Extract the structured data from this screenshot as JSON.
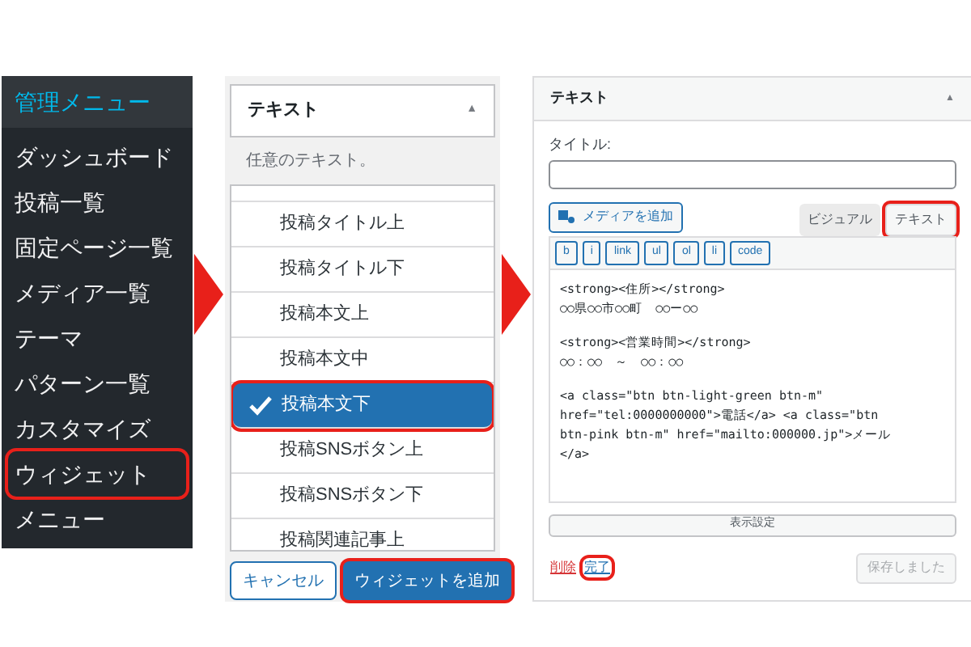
{
  "admin_menu": {
    "title": "管理メニュー",
    "items": [
      {
        "label": "ダッシュボード",
        "highlighted": false
      },
      {
        "label": "投稿一覧",
        "highlighted": false
      },
      {
        "label": "固定ページ一覧",
        "highlighted": false
      },
      {
        "label": "メディア一覧",
        "highlighted": false
      },
      {
        "label": "テーマ",
        "highlighted": false
      },
      {
        "label": "パターン一覧",
        "highlighted": false
      },
      {
        "label": "カスタマイズ",
        "highlighted": false
      },
      {
        "label": "ウィジェット",
        "highlighted": true
      },
      {
        "label": "メニュー",
        "highlighted": false
      }
    ]
  },
  "widget_chooser": {
    "title": "テキスト",
    "toggle": "▲",
    "description": "任意のテキスト。",
    "areas": [
      {
        "label": "投稿タイトル上",
        "selected": false
      },
      {
        "label": "投稿タイトル下",
        "selected": false
      },
      {
        "label": "投稿本文上",
        "selected": false
      },
      {
        "label": "投稿本文中",
        "selected": false
      },
      {
        "label": "投稿本文下",
        "selected": true
      },
      {
        "label": "投稿SNSボタン上",
        "selected": false
      },
      {
        "label": "投稿SNSボタン下",
        "selected": false
      },
      {
        "label": "投稿関連記事上",
        "selected": false
      }
    ],
    "buttons": [
      {
        "label": "キャンセル",
        "kind": "secondary",
        "highlighted": false
      },
      {
        "label": "ウィジェットを追加",
        "kind": "primary",
        "highlighted": true
      }
    ]
  },
  "text_widget": {
    "title": "テキスト",
    "toggle": "▲",
    "title_label": "タイトル:",
    "media_button": "メディアを追加",
    "editor_tabs": [
      {
        "label": "ビジュアル",
        "selected": false,
        "highlighted": false
      },
      {
        "label": "テキスト",
        "selected": true,
        "highlighted": true
      }
    ],
    "quicktags": [
      "b",
      "i",
      "link",
      "ul",
      "ol",
      "li",
      "code"
    ],
    "content": [
      [
        "<strong><住所></strong>",
        "○○県○○市○○町　○○ー○○"
      ],
      [
        "<strong><営業時間></strong>",
        "○○：○○　～　○○：○○"
      ],
      [
        "<a class=\"btn btn-light-green btn-m\"",
        "href=\"tel:0000000000\">電話</a> <a class=\"btn",
        "btn-pink btn-m\" href=\"mailto:000000.jp\">メール",
        "</a>"
      ]
    ],
    "visibility_button": "表示設定",
    "links": [
      {
        "label": "削除",
        "kind": "delete",
        "highlighted": false
      },
      {
        "label": "完了",
        "kind": "done",
        "highlighted": true
      }
    ],
    "save_button": {
      "label": "保存しました",
      "disabled": true
    }
  }
}
